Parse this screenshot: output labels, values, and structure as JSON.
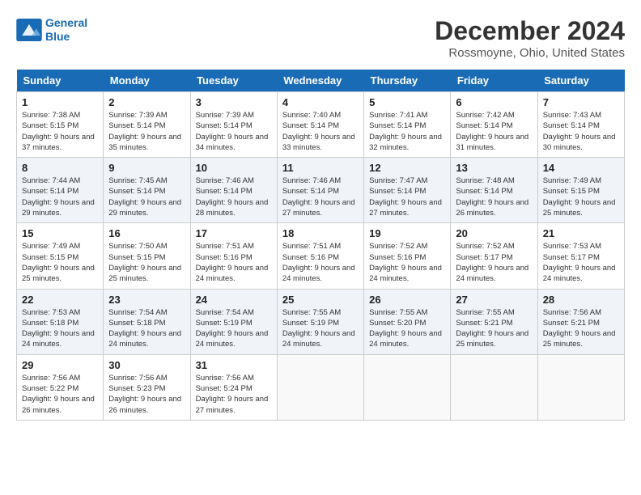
{
  "header": {
    "logo_line1": "General",
    "logo_line2": "Blue",
    "title": "December 2024",
    "subtitle": "Rossmoyne, Ohio, United States"
  },
  "weekdays": [
    "Sunday",
    "Monday",
    "Tuesday",
    "Wednesday",
    "Thursday",
    "Friday",
    "Saturday"
  ],
  "weeks": [
    [
      {
        "day": "1",
        "rise": "Sunrise: 7:38 AM",
        "set": "Sunset: 5:15 PM",
        "daylight": "Daylight: 9 hours and 37 minutes."
      },
      {
        "day": "2",
        "rise": "Sunrise: 7:39 AM",
        "set": "Sunset: 5:14 PM",
        "daylight": "Daylight: 9 hours and 35 minutes."
      },
      {
        "day": "3",
        "rise": "Sunrise: 7:39 AM",
        "set": "Sunset: 5:14 PM",
        "daylight": "Daylight: 9 hours and 34 minutes."
      },
      {
        "day": "4",
        "rise": "Sunrise: 7:40 AM",
        "set": "Sunset: 5:14 PM",
        "daylight": "Daylight: 9 hours and 33 minutes."
      },
      {
        "day": "5",
        "rise": "Sunrise: 7:41 AM",
        "set": "Sunset: 5:14 PM",
        "daylight": "Daylight: 9 hours and 32 minutes."
      },
      {
        "day": "6",
        "rise": "Sunrise: 7:42 AM",
        "set": "Sunset: 5:14 PM",
        "daylight": "Daylight: 9 hours and 31 minutes."
      },
      {
        "day": "7",
        "rise": "Sunrise: 7:43 AM",
        "set": "Sunset: 5:14 PM",
        "daylight": "Daylight: 9 hours and 30 minutes."
      }
    ],
    [
      {
        "day": "8",
        "rise": "Sunrise: 7:44 AM",
        "set": "Sunset: 5:14 PM",
        "daylight": "Daylight: 9 hours and 29 minutes."
      },
      {
        "day": "9",
        "rise": "Sunrise: 7:45 AM",
        "set": "Sunset: 5:14 PM",
        "daylight": "Daylight: 9 hours and 29 minutes."
      },
      {
        "day": "10",
        "rise": "Sunrise: 7:46 AM",
        "set": "Sunset: 5:14 PM",
        "daylight": "Daylight: 9 hours and 28 minutes."
      },
      {
        "day": "11",
        "rise": "Sunrise: 7:46 AM",
        "set": "Sunset: 5:14 PM",
        "daylight": "Daylight: 9 hours and 27 minutes."
      },
      {
        "day": "12",
        "rise": "Sunrise: 7:47 AM",
        "set": "Sunset: 5:14 PM",
        "daylight": "Daylight: 9 hours and 27 minutes."
      },
      {
        "day": "13",
        "rise": "Sunrise: 7:48 AM",
        "set": "Sunset: 5:14 PM",
        "daylight": "Daylight: 9 hours and 26 minutes."
      },
      {
        "day": "14",
        "rise": "Sunrise: 7:49 AM",
        "set": "Sunset: 5:15 PM",
        "daylight": "Daylight: 9 hours and 25 minutes."
      }
    ],
    [
      {
        "day": "15",
        "rise": "Sunrise: 7:49 AM",
        "set": "Sunset: 5:15 PM",
        "daylight": "Daylight: 9 hours and 25 minutes."
      },
      {
        "day": "16",
        "rise": "Sunrise: 7:50 AM",
        "set": "Sunset: 5:15 PM",
        "daylight": "Daylight: 9 hours and 25 minutes."
      },
      {
        "day": "17",
        "rise": "Sunrise: 7:51 AM",
        "set": "Sunset: 5:16 PM",
        "daylight": "Daylight: 9 hours and 24 minutes."
      },
      {
        "day": "18",
        "rise": "Sunrise: 7:51 AM",
        "set": "Sunset: 5:16 PM",
        "daylight": "Daylight: 9 hours and 24 minutes."
      },
      {
        "day": "19",
        "rise": "Sunrise: 7:52 AM",
        "set": "Sunset: 5:16 PM",
        "daylight": "Daylight: 9 hours and 24 minutes."
      },
      {
        "day": "20",
        "rise": "Sunrise: 7:52 AM",
        "set": "Sunset: 5:17 PM",
        "daylight": "Daylight: 9 hours and 24 minutes."
      },
      {
        "day": "21",
        "rise": "Sunrise: 7:53 AM",
        "set": "Sunset: 5:17 PM",
        "daylight": "Daylight: 9 hours and 24 minutes."
      }
    ],
    [
      {
        "day": "22",
        "rise": "Sunrise: 7:53 AM",
        "set": "Sunset: 5:18 PM",
        "daylight": "Daylight: 9 hours and 24 minutes."
      },
      {
        "day": "23",
        "rise": "Sunrise: 7:54 AM",
        "set": "Sunset: 5:18 PM",
        "daylight": "Daylight: 9 hours and 24 minutes."
      },
      {
        "day": "24",
        "rise": "Sunrise: 7:54 AM",
        "set": "Sunset: 5:19 PM",
        "daylight": "Daylight: 9 hours and 24 minutes."
      },
      {
        "day": "25",
        "rise": "Sunrise: 7:55 AM",
        "set": "Sunset: 5:19 PM",
        "daylight": "Daylight: 9 hours and 24 minutes."
      },
      {
        "day": "26",
        "rise": "Sunrise: 7:55 AM",
        "set": "Sunset: 5:20 PM",
        "daylight": "Daylight: 9 hours and 24 minutes."
      },
      {
        "day": "27",
        "rise": "Sunrise: 7:55 AM",
        "set": "Sunset: 5:21 PM",
        "daylight": "Daylight: 9 hours and 25 minutes."
      },
      {
        "day": "28",
        "rise": "Sunrise: 7:56 AM",
        "set": "Sunset: 5:21 PM",
        "daylight": "Daylight: 9 hours and 25 minutes."
      }
    ],
    [
      {
        "day": "29",
        "rise": "Sunrise: 7:56 AM",
        "set": "Sunset: 5:22 PM",
        "daylight": "Daylight: 9 hours and 26 minutes."
      },
      {
        "day": "30",
        "rise": "Sunrise: 7:56 AM",
        "set": "Sunset: 5:23 PM",
        "daylight": "Daylight: 9 hours and 26 minutes."
      },
      {
        "day": "31",
        "rise": "Sunrise: 7:56 AM",
        "set": "Sunset: 5:24 PM",
        "daylight": "Daylight: 9 hours and 27 minutes."
      },
      null,
      null,
      null,
      null
    ]
  ]
}
